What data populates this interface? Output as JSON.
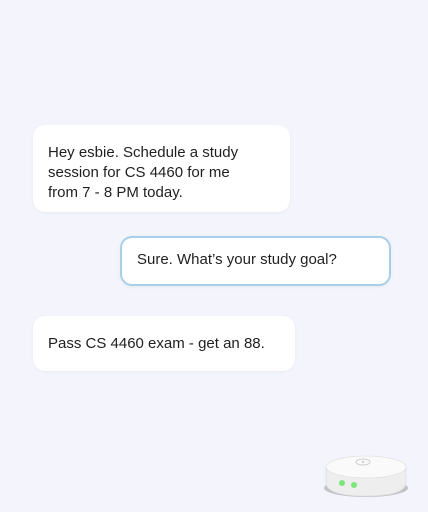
{
  "conversation": {
    "messages": [
      {
        "role": "user",
        "lines": [
          "Hey esbie. Schedule a study",
          "session for CS 4460 for me",
          "from 7 - 8 PM today."
        ]
      },
      {
        "role": "assistant",
        "text": "Sure. What’s your study goal?"
      },
      {
        "role": "user",
        "text": "Pass CS 4460 exam - get an 88."
      }
    ]
  },
  "device": {
    "icon": "smart-speaker-icon",
    "light_color": "#7ee57a",
    "body_color": "#f4f4f4"
  },
  "colors": {
    "background": "#f3f4fc",
    "bubble": "#ffffff",
    "assistant_border": "#a9cfe8",
    "text": "#1f1f1f"
  }
}
